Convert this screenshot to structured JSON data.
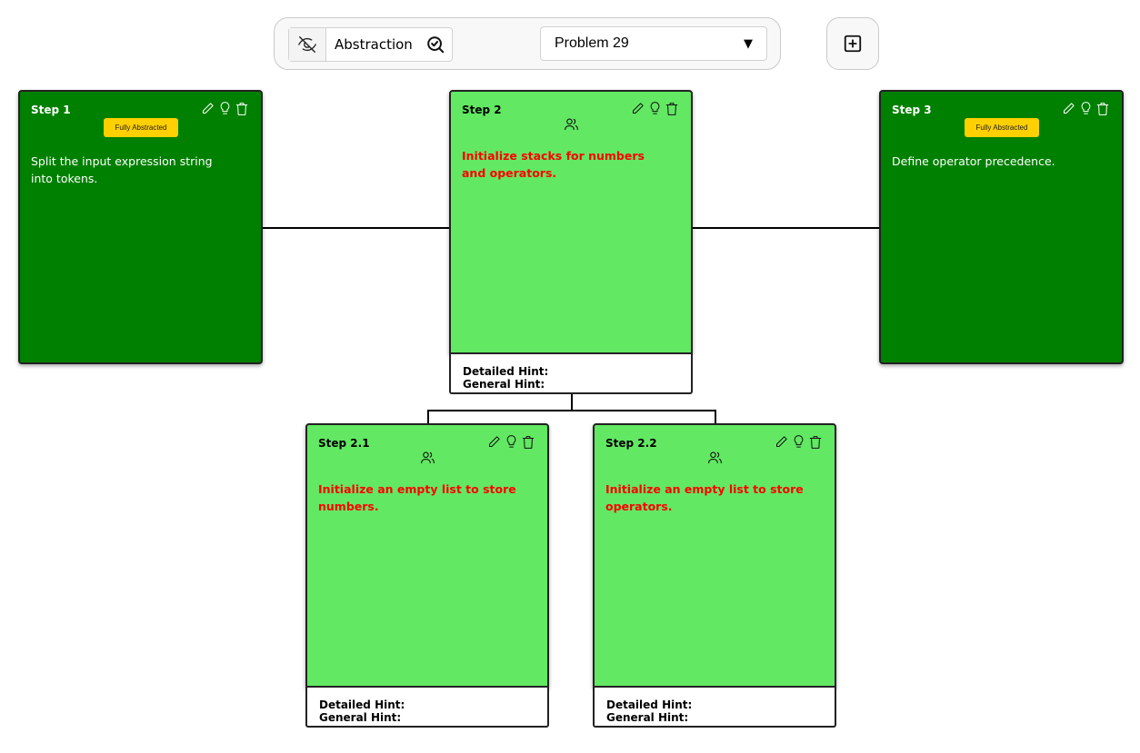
{
  "toolbar": {
    "abstraction_label": "Abstraction",
    "problem_selected": "Problem 29",
    "dropdown_arrow": "▼"
  },
  "icons": {
    "hide": "eye-off-icon",
    "search": "search-check-icon",
    "add": "plus-square-icon",
    "edit": "pencil-icon",
    "hint": "lightbulb-icon",
    "delete": "trash-icon",
    "collab": "users-icon"
  },
  "colors": {
    "abstracted_card": "#008000",
    "open_card": "#62e863",
    "badge": "#ffd000",
    "open_text": "#ff0000"
  },
  "steps": {
    "s1": {
      "title": "Step 1",
      "badge": "Fully Abstracted",
      "text": "Split the input expression string into tokens."
    },
    "s2": {
      "title": "Step 2",
      "text": "Initialize stacks for numbers and operators.",
      "detailed_hint": "Detailed Hint:",
      "general_hint": "General Hint:"
    },
    "s3": {
      "title": "Step 3",
      "badge": "Fully Abstracted",
      "text": "Define operator precedence."
    },
    "s21": {
      "title": "Step 2.1",
      "text": "Initialize an empty list to store numbers.",
      "detailed_hint": "Detailed Hint:",
      "general_hint": "General Hint:"
    },
    "s22": {
      "title": "Step 2.2",
      "text": "Initialize an empty list to store operators.",
      "detailed_hint": "Detailed Hint:",
      "general_hint": "General Hint:"
    }
  }
}
